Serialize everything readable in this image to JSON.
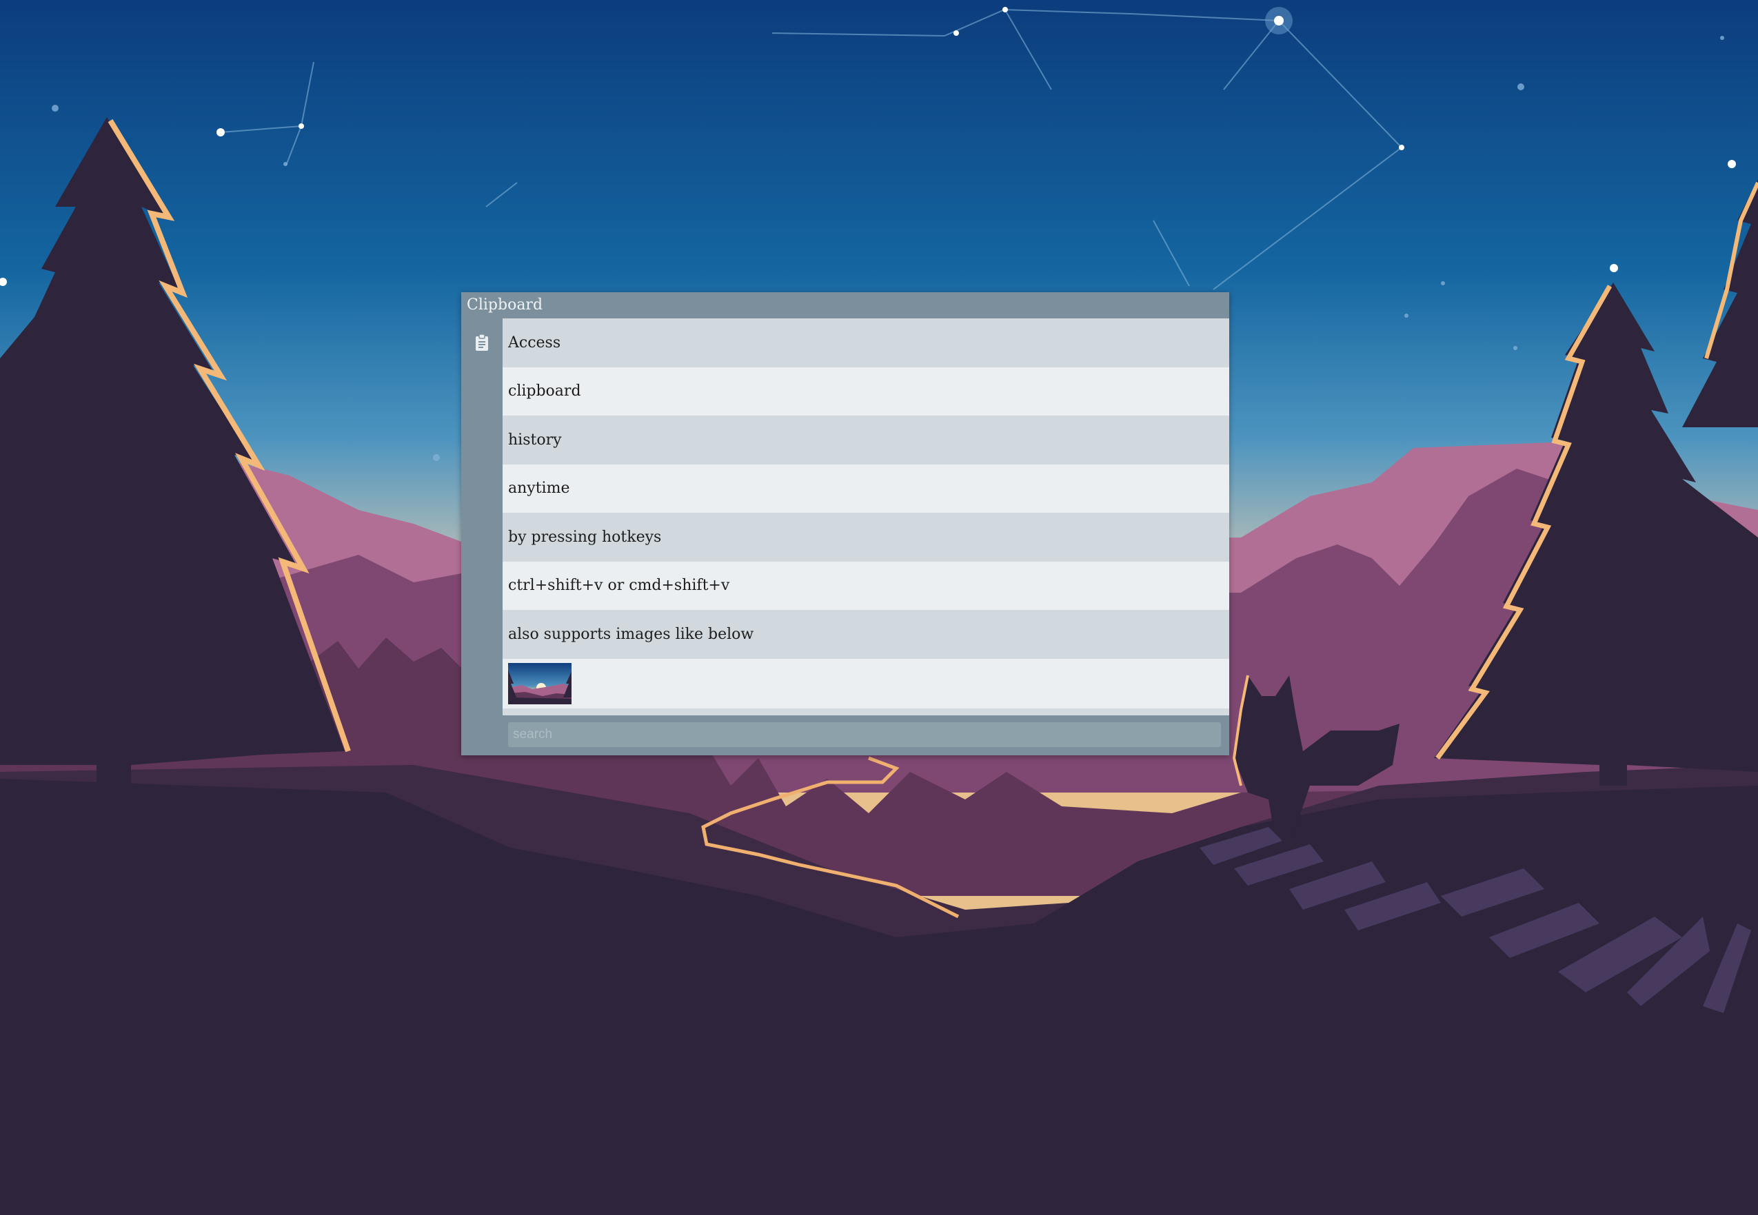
{
  "window": {
    "title": "Clipboard"
  },
  "sidebar": {
    "icon": "clipboard-icon"
  },
  "clipboard": {
    "items": [
      "Access",
      "clipboard",
      "history",
      "anytime",
      "by pressing hotkeys",
      "ctrl+shift+v or cmd+shift+v",
      "also supports images like below"
    ]
  },
  "search": {
    "placeholder": "search",
    "value": ""
  },
  "colors": {
    "window_bg": "#7b909c",
    "row_alt_1": "#d2d9de",
    "row_alt_2": "#ebeff1",
    "sky_top": "#0d3f7e",
    "sky_bottom": "#f1c48a",
    "ground": "#2e243b"
  }
}
